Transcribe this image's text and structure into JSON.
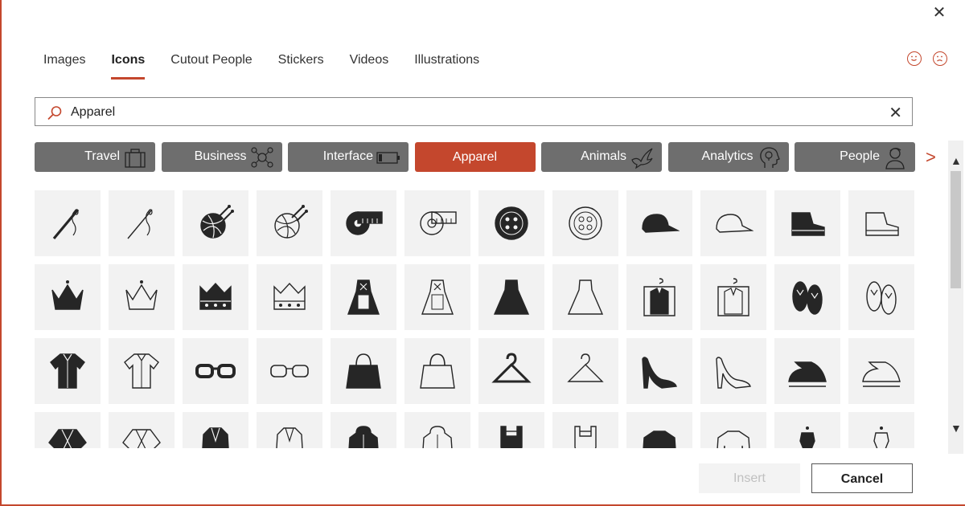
{
  "tabs": [
    {
      "label": "Images",
      "active": false
    },
    {
      "label": "Icons",
      "active": true
    },
    {
      "label": "Cutout People",
      "active": false
    },
    {
      "label": "Stickers",
      "active": false
    },
    {
      "label": "Videos",
      "active": false
    },
    {
      "label": "Illustrations",
      "active": false
    }
  ],
  "search": {
    "value": "Apparel"
  },
  "chips": [
    {
      "label": "Travel",
      "icon": "suitcase-icon"
    },
    {
      "label": "Business",
      "icon": "network-icon"
    },
    {
      "label": "Interface",
      "icon": "battery-icon"
    },
    {
      "label": "Apparel",
      "icon": "",
      "active": true
    },
    {
      "label": "Animals",
      "icon": "dove-icon"
    },
    {
      "label": "Analytics",
      "icon": "head-idea-icon"
    },
    {
      "label": "People",
      "icon": "person-icon"
    }
  ],
  "icons": [
    [
      "needle-thread-icon",
      "needle-thread-outline-icon",
      "yarn-ball-icon",
      "yarn-ball-outline-icon",
      "tape-measure-icon",
      "tape-measure-outline-icon",
      "button-icon",
      "button-outline-icon",
      "cap-icon",
      "cap-outline-icon",
      "boot-icon",
      "boot-outline-icon"
    ],
    [
      "crown-icon",
      "crown-outline-icon",
      "crown-jewels-icon",
      "crown-jewels-outline-icon",
      "dirndl-icon",
      "dirndl-outline-icon",
      "dress-icon",
      "dress-outline-icon",
      "suit-bag-icon",
      "suit-bag-outline-icon",
      "flip-flops-icon",
      "flip-flops-outline-icon"
    ],
    [
      "shirt-icon",
      "shirt-outline-icon",
      "glasses-icon",
      "glasses-outline-icon",
      "handbag-icon",
      "handbag-outline-icon",
      "hanger-icon",
      "hanger-outline-icon",
      "high-heel-icon",
      "high-heel-outline-icon",
      "iron-icon",
      "iron-outline-icon"
    ],
    [
      "kimono-icon",
      "kimono-outline-icon",
      "jacket-icon",
      "jacket-outline-icon",
      "hoodie-icon",
      "hoodie-outline-icon",
      "lederhosen-icon",
      "lederhosen-outline-icon",
      "sweater-icon",
      "sweater-outline-icon",
      "mannequin-icon",
      "mannequin-outline-icon"
    ]
  ],
  "buttons": {
    "insert": "Insert",
    "cancel": "Cancel"
  },
  "colors": {
    "accent": "#c4472d",
    "chip": "#6e6e6e",
    "tile": "#f2f2f2",
    "icon": "#262626"
  }
}
